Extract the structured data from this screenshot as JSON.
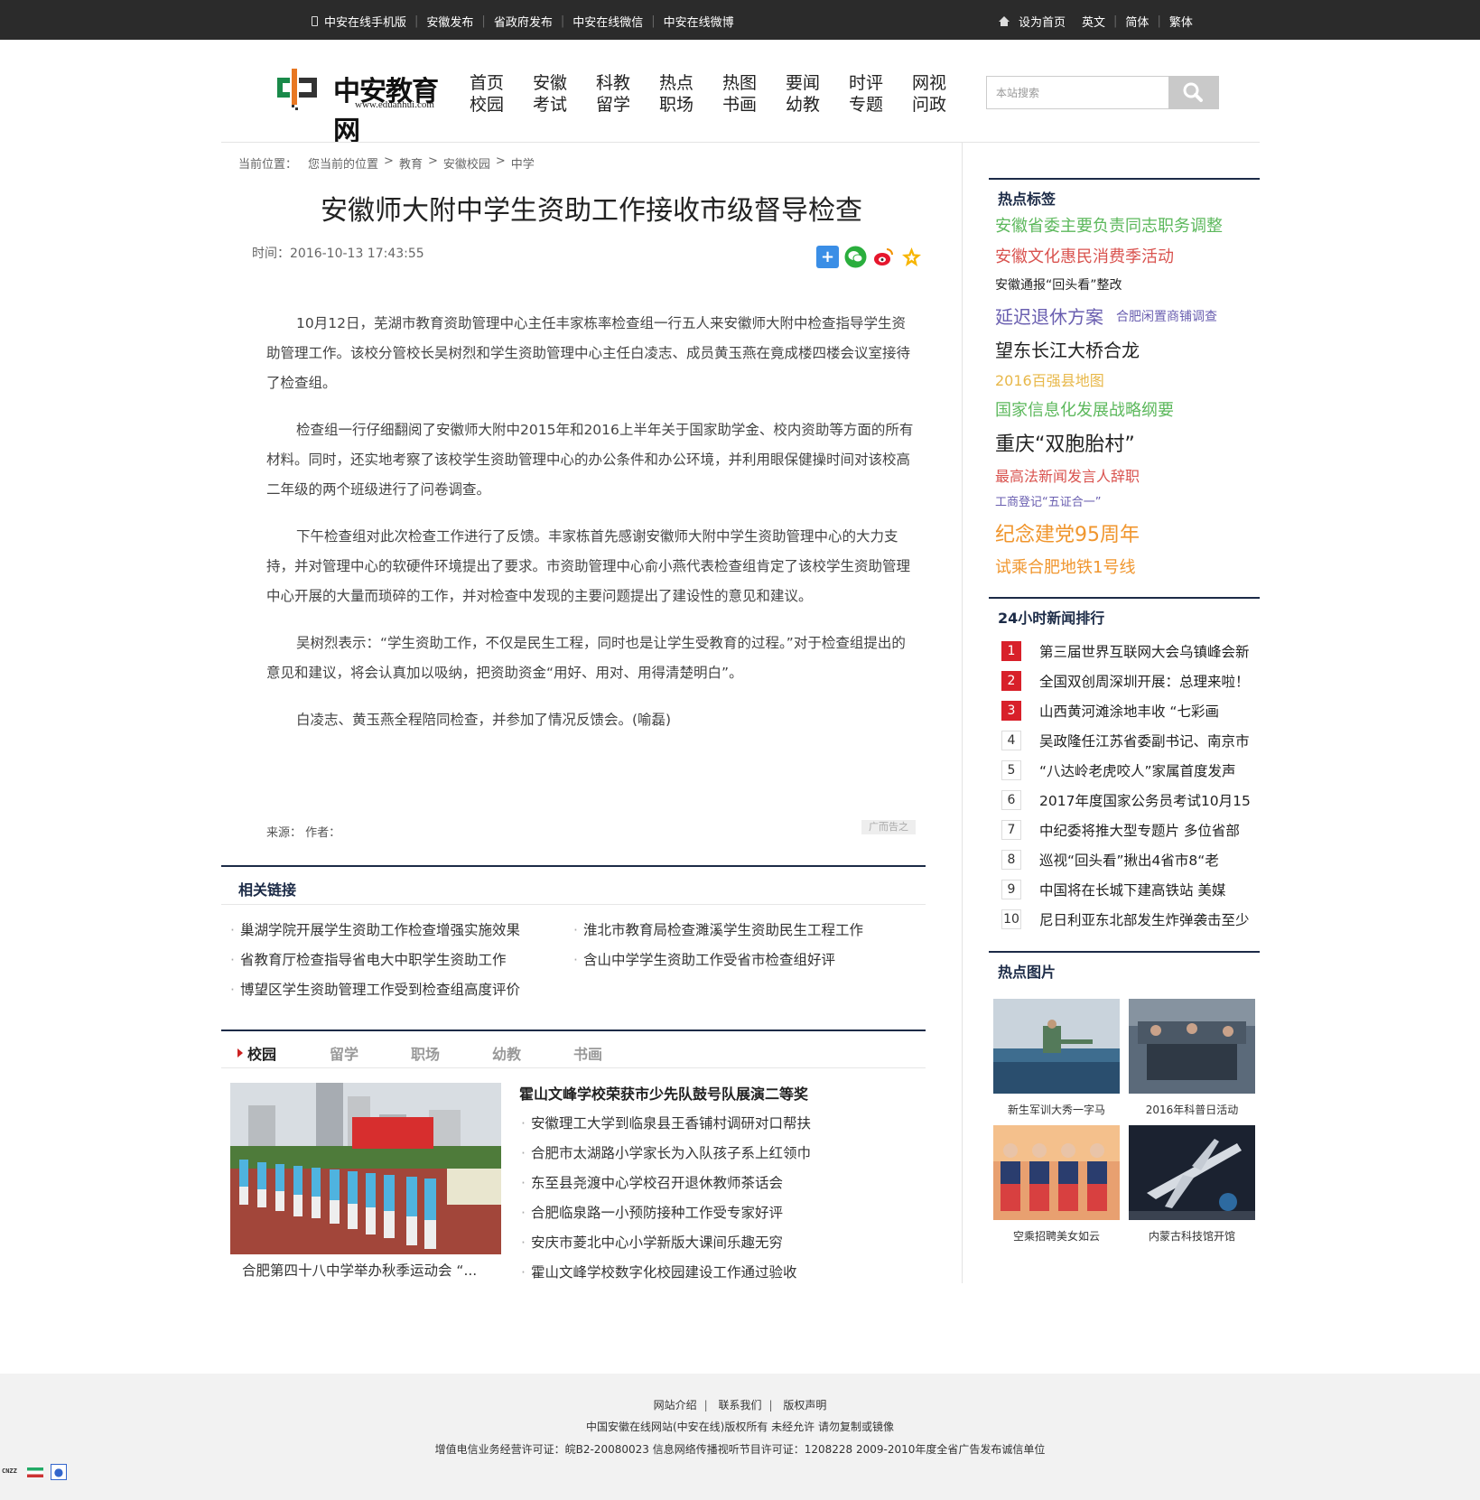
{
  "topbar": {
    "left_links": [
      "中安在线手机版",
      "安徽发布",
      "省政府发布",
      "中安在线微信",
      "中安在线微博"
    ],
    "right_links": [
      "设为首页",
      "英文",
      "简体",
      "繁体"
    ]
  },
  "logo": {
    "name": "中安教育网",
    "url": "www.eduanhui.com"
  },
  "nav": [
    [
      "首页",
      "校园"
    ],
    [
      "安徽",
      "考试"
    ],
    [
      "科教",
      "留学"
    ],
    [
      "热点",
      "职场"
    ],
    [
      "热图",
      "书画"
    ],
    [
      "要闻",
      "幼教"
    ],
    [
      "时评",
      "专题"
    ],
    [
      "网视",
      "问政"
    ]
  ],
  "search": {
    "placeholder": "本站搜索"
  },
  "breadcrumb": {
    "label": "当前位置：",
    "items": [
      "您当前的位置",
      "教育",
      "安徽校园",
      "中学"
    ]
  },
  "article": {
    "title": "安徽师大附中学生资助工作接收市级督导检查",
    "time": "时间：2016-10-13 17:43:55",
    "paragraphs": [
      "10月12日，芜湖市教育资助管理中心主任丰家栋率检查组一行五人来安徽师大附中检查指导学生资助管理工作。该校分管校长吴树烈和学生资助管理中心主任白凌志、成员黄玉燕在竟成楼四楼会议室接待了检查组。",
      "检查组一行仔细翻阅了安徽师大附中2015年和2016上半年关于国家助学金、校内资助等方面的所有材料。同时，还实地考察了该校学生资助管理中心的办公条件和办公环境，并利用眼保健操时间对该校高二年级的两个班级进行了问卷调查。",
      "下午检查组对此次检查工作进行了反馈。丰家栋首先感谢安徽师大附中学生资助管理中心的大力支持，并对管理中心的软硬件环境提出了要求。市资助管理中心俞小燕代表检查组肯定了该校学生资助管理中心开展的大量而琐碎的工作，并对检查中发现的主要问题提出了建设性的意见和建议。",
      "吴树烈表示：“学生资助工作，不仅是民生工程，同时也是让学生受教育的过程。”对于检查组提出的意见和建议，将会认真加以吸纳，把资助资金“用好、用对、用得清楚明白”。",
      "白凌志、黄玉燕全程陪同检查，并参加了情况反馈会。(喻磊)"
    ],
    "source": "来源：  作者：",
    "ad_tag": "广而告之"
  },
  "related": {
    "title": "相关链接",
    "items": [
      "巢湖学院开展学生资助工作检查增强实施效果",
      "淮北市教育局检查濉溪学生资助民生工程工作",
      "省教育厅检查指导省电大中职学生资助工作",
      "含山中学学生资助工作受省市检查组好评",
      "博望区学生资助管理工作受到检查组高度评价"
    ]
  },
  "tabs": [
    "校园",
    "留学",
    "职场",
    "幼教",
    "书画"
  ],
  "campus": {
    "caption": "合肥第四十八中学举办秋季运动会 “...",
    "headline": "霍山文峰学校荣获市少先队鼓号队展演二等奖",
    "items": [
      "安徽理工大学到临泉县王香铺村调研对口帮扶",
      "合肥市太湖路小学家长为入队孩子系上红领巾",
      "东至县尧渡中心学校召开退休教师茶话会",
      "合肥临泉路一小预防接种工作受专家好评",
      "安庆市菱北中心小学新版大课间乐趣无穷",
      "霍山文峰学校数字化校园建设工作通过验收"
    ]
  },
  "sidebar": {
    "hot_tags_title": "热点标签",
    "tags": [
      {
        "text": "安徽省委主要负责同志职务调整",
        "color": "#5cb85c"
      },
      {
        "text": "安徽文化惠民消费季活动",
        "color": "#d9534f"
      },
      {
        "text": "安徽通报“回头看”整改",
        "color": "#222222"
      },
      {
        "text": "延迟退休方案",
        "color": "#6a5fb0"
      },
      {
        "text": "合肥闲置商铺调查",
        "color": "#6a5fb0"
      },
      {
        "text": "望东长江大桥合龙",
        "color": "#222222"
      },
      {
        "text": "2016百强县地图",
        "color": "#e8b84a"
      },
      {
        "text": "国家信息化发展战略纲要",
        "color": "#5cb85c"
      },
      {
        "text": "重庆“双胞胎村”",
        "color": "#222222"
      },
      {
        "text": "最高法新闻发言人辞职",
        "color": "#d9534f"
      },
      {
        "text": "工商登记“五证合一”",
        "color": "#6a5fb0"
      },
      {
        "text": "纪念建党95周年",
        "color": "#f0962e"
      },
      {
        "text": "试乘合肥地铁1号线",
        "color": "#f0962e"
      }
    ],
    "rank_title": "24小时新闻排行",
    "rank": [
      {
        "n": "1",
        "text": "第三届世界互联网大会乌镇峰会新"
      },
      {
        "n": "2",
        "text": "全国双创周深圳开展：总理来啦！"
      },
      {
        "n": "3",
        "text": "山西黄河滩涂地丰收 “七彩画"
      },
      {
        "n": "4",
        "text": "吴政隆任江苏省委副书记、南京市"
      },
      {
        "n": "5",
        "text": "“八达岭老虎咬人”家属首度发声"
      },
      {
        "n": "6",
        "text": "2017年度国家公务员考试10月15"
      },
      {
        "n": "7",
        "text": "中纪委将推大型专题片 多位省部"
      },
      {
        "n": "8",
        "text": "巡视“回头看”揪出4省市8“老"
      },
      {
        "n": "9",
        "text": "中国将在长城下建高铁站 美媒"
      },
      {
        "n": "10",
        "text": "尼日利亚东北部发生炸弹袭击至少"
      }
    ],
    "pics_title": "热点图片",
    "pics": [
      "新生军训大秀一字马",
      "2016年科普日活动",
      "空乘招聘美女如云",
      "内蒙古科技馆开馆"
    ]
  },
  "footer": {
    "links": [
      "网站介绍",
      "联系我们",
      "版权声明"
    ],
    "copyright": "中国安徽在线网站(中安在线)版权所有 未经允许 请勿复制或镜像",
    "license": "增值电信业务经营许可证：皖B2-20080023 信息网络传播视听节目许可证：1208228  2009-2010年度全省广告发布诚信单位",
    "cnzz": "CNZZ"
  }
}
